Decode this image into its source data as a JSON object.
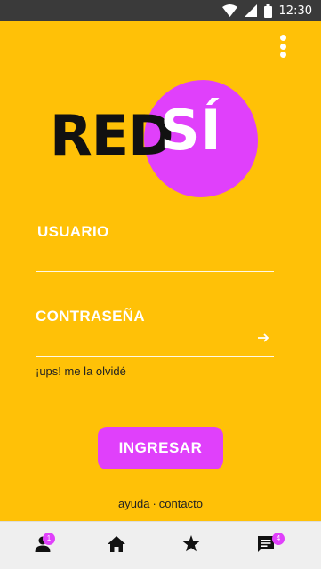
{
  "status_bar": {
    "time": "12:30"
  },
  "logo": {
    "part1": "RED",
    "part2": "SÍ"
  },
  "form": {
    "user_label": "USUARIO",
    "password_label": "CONTRASEÑA",
    "user_value": "",
    "password_value": "",
    "forgot_link": "¡ups! me la olvidé",
    "submit_label": "INGRESAR"
  },
  "footer": {
    "help": "ayuda",
    "separator": "·",
    "contact": "contacto"
  },
  "bottom_nav": {
    "items": [
      {
        "icon": "person-icon",
        "badge": "1"
      },
      {
        "icon": "home-icon",
        "badge": ""
      },
      {
        "icon": "star-icon",
        "badge": ""
      },
      {
        "icon": "chat-icon",
        "badge": "4"
      }
    ]
  },
  "colors": {
    "background": "#FFC107",
    "accent": "#E040FB",
    "status_bar": "#3a3a3a",
    "nav_bg": "#efefef"
  }
}
